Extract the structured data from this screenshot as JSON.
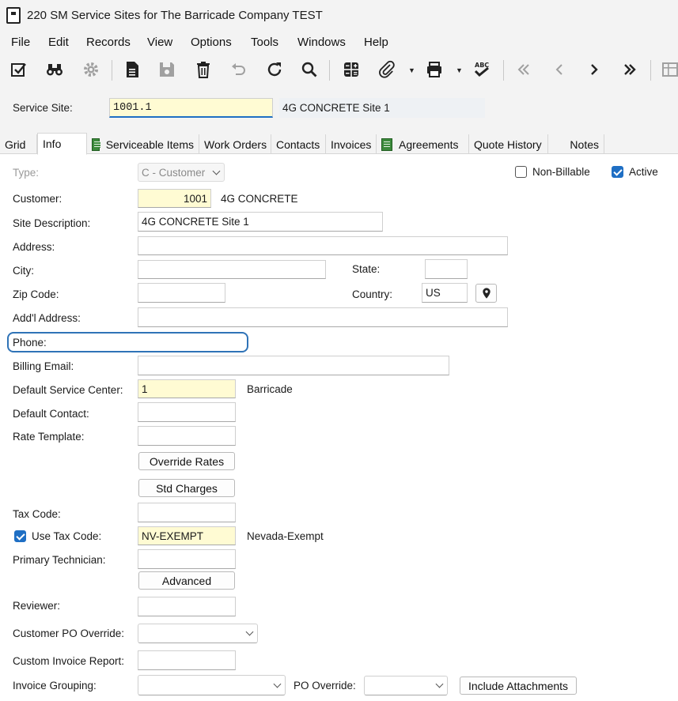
{
  "window": {
    "title": "220 SM Service Sites for The Barricade Company TEST"
  },
  "menu": [
    "File",
    "Edit",
    "Records",
    "View",
    "Options",
    "Tools",
    "Windows",
    "Help"
  ],
  "toolbar": {
    "icons": [
      "edit-check-icon",
      "binoculars-icon",
      "gear-icon",
      "new-document-icon",
      "save-icon",
      "delete-icon",
      "undo-icon",
      "refresh-icon",
      "search-icon",
      "calculator-icon",
      "attachment-icon",
      "print-icon",
      "spellcheck-icon",
      "first-record-icon",
      "previous-record-icon",
      "next-record-icon",
      "last-record-icon",
      "grid-icon"
    ]
  },
  "header": {
    "service_site_label": "Service Site:",
    "service_site_value": "1001.1",
    "service_site_desc": "4G CONCRETE Site 1"
  },
  "tabs": [
    "Grid",
    "Info",
    "Serviceable Items",
    "Work Orders",
    "Contacts",
    "Invoices",
    "Agreements",
    "Quote History",
    "Notes"
  ],
  "form": {
    "type_label": "Type:",
    "type_value": "C - Customer",
    "non_billable_label": "Non-Billable",
    "non_billable_checked": false,
    "active_label": "Active",
    "active_checked": true,
    "customer_label": "Customer:",
    "customer_value": "1001",
    "customer_name": "4G CONCRETE",
    "site_description_label": "Site Description:",
    "site_description_value": "4G CONCRETE Site 1",
    "address_label": "Address:",
    "address_value": "",
    "city_label": "City:",
    "city_value": "",
    "state_label": "State:",
    "state_value": "",
    "zip_label": "Zip Code:",
    "zip_value": "",
    "country_label": "Country:",
    "country_value": "US",
    "addl_address_label": "Add'l Address:",
    "addl_address_value": "",
    "phone_label": "Phone:",
    "phone_value": "",
    "billing_email_label": "Billing Email:",
    "billing_email_value": "",
    "default_service_center_label": "Default Service Center:",
    "default_service_center_value": "1",
    "default_service_center_name": "Barricade",
    "default_contact_label": "Default Contact:",
    "default_contact_value": "",
    "rate_template_label": "Rate Template:",
    "rate_template_value": "",
    "override_rates_button": "Override Rates",
    "std_charges_button": "Std Charges",
    "tax_code_label": "Tax Code:",
    "tax_code_value": "",
    "use_tax_code_label": "Use Tax Code:",
    "use_tax_code_checked": true,
    "use_tax_code_value": "NV-EXEMPT",
    "use_tax_code_name": "Nevada-Exempt",
    "primary_technician_label": "Primary Technician:",
    "primary_technician_value": "",
    "advanced_button": "Advanced",
    "reviewer_label": "Reviewer:",
    "reviewer_value": "",
    "customer_po_override_label": "Customer PO Override:",
    "customer_po_override_value": "",
    "custom_invoice_report_label": "Custom Invoice Report:",
    "custom_invoice_report_value": "",
    "invoice_grouping_label": "Invoice Grouping:",
    "invoice_grouping_value": "",
    "po_override_label": "PO Override:",
    "po_override_value": "",
    "include_attachments_button": "Include Attachments"
  },
  "colors": {
    "required_field": "#fffbd3",
    "accent": "#1f6fc4",
    "highlight_outline": "#2f73b7",
    "chrome": "#f3f3f3"
  }
}
